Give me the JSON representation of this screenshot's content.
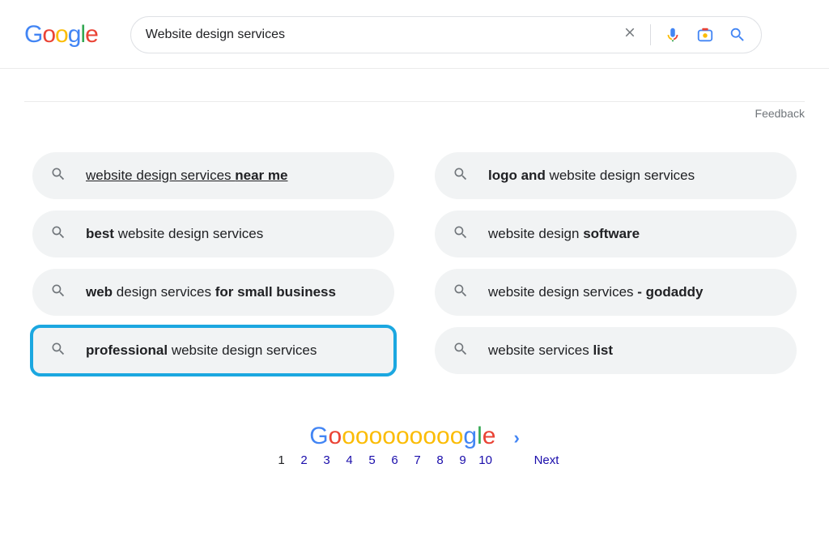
{
  "logo": {
    "g1": "G",
    "o1": "o",
    "o2": "o",
    "g2": "g",
    "l": "l",
    "e": "e"
  },
  "search": {
    "value": "Website design services"
  },
  "feedback_label": "Feedback",
  "related": [
    {
      "parts": [
        "website design services ",
        "near me"
      ],
      "bold": [
        false,
        true
      ],
      "hovered": true
    },
    {
      "parts": [
        "logo and ",
        "website design services"
      ],
      "bold": [
        true,
        false
      ]
    },
    {
      "parts": [
        "best ",
        "website design services"
      ],
      "bold": [
        true,
        false
      ]
    },
    {
      "parts": [
        "website design ",
        "software"
      ],
      "bold": [
        false,
        true
      ]
    },
    {
      "parts": [
        "web ",
        "design services ",
        "for small business"
      ],
      "bold": [
        true,
        false,
        true
      ]
    },
    {
      "parts": [
        "website design services ",
        "- godaddy"
      ],
      "bold": [
        false,
        true
      ]
    },
    {
      "parts": [
        "professional ",
        "website design services"
      ],
      "bold": [
        true,
        false
      ],
      "highlight": true
    },
    {
      "parts": [
        "website services ",
        "list"
      ],
      "bold": [
        false,
        true
      ]
    }
  ],
  "pagination": {
    "current": 1,
    "pages": [
      1,
      2,
      3,
      4,
      5,
      6,
      7,
      8,
      9,
      10
    ],
    "next_label": "Next"
  }
}
